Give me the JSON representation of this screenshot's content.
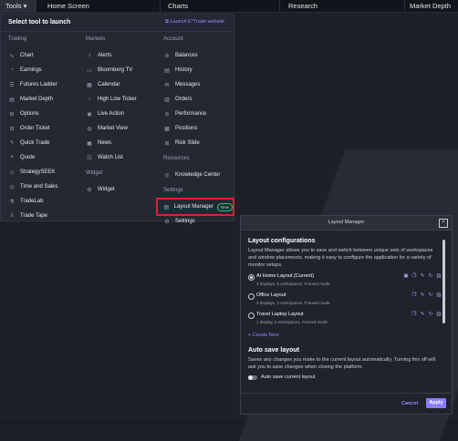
{
  "topbar": {
    "tabs": [
      "Tools",
      "Home Screen",
      "Charts",
      "Research",
      "Market Depth"
    ]
  },
  "launch": {
    "title": "Select tool to launch",
    "link": "Launch E*Trade website",
    "trading": {
      "heading": "Trading",
      "items": [
        "Chart",
        "Earnings",
        "Futures Ladder",
        "Market Depth",
        "Options",
        "Order Ticket",
        "Quick Trade",
        "Quote",
        "StrategySEEK",
        "Time and Sales",
        "TradeLab",
        "Trade Tape"
      ]
    },
    "markets": {
      "heading": "Markets",
      "items": [
        "Alerts",
        "Bloomberg TV",
        "Calendar",
        "High Low Ticker",
        "Live Action",
        "Market View",
        "News",
        "Watch List"
      ],
      "widget_heading": "Widget",
      "widget_items": [
        "Widget"
      ]
    },
    "account": {
      "heading": "Account",
      "items": [
        "Balances",
        "History",
        "Messages",
        "Orders",
        "Performance",
        "Positions",
        "Risk Slide"
      ],
      "resources_heading": "Resources",
      "resources_items": [
        "Knowledge Center"
      ],
      "settings_heading": "Settings",
      "layout_manager": "Layout Manager",
      "new_badge": "New",
      "settings_item": "Settings"
    }
  },
  "dialog": {
    "title": "Layout Manager",
    "section1_title": "Layout configurations",
    "section1_text": "Layout Manager allows you to save and switch between unique sets of workspaces and window placements, making it easy to configure the application for a variety of monitor setups.",
    "layouts": [
      {
        "name": "At Home Layout (Current)",
        "detail": "3 displays, 6 workspaces, Framed mode",
        "selected": true
      },
      {
        "name": "Office Layout",
        "detail": "3 displays, 2 workspaces, Framed mode",
        "selected": false
      },
      {
        "name": "Travel Laptop Layout",
        "detail": "1 display, 2 workspaces, Framed mode",
        "selected": false
      }
    ],
    "create_new": "+ Create New",
    "section2_title": "Auto save layout",
    "section2_text": "Saves any changes you make to the current layout automatically. Turning this off will ask you to save changes when closing the platform.",
    "toggle_label": "Auto save current layout",
    "cancel": "Cancel",
    "apply": "Apply"
  }
}
